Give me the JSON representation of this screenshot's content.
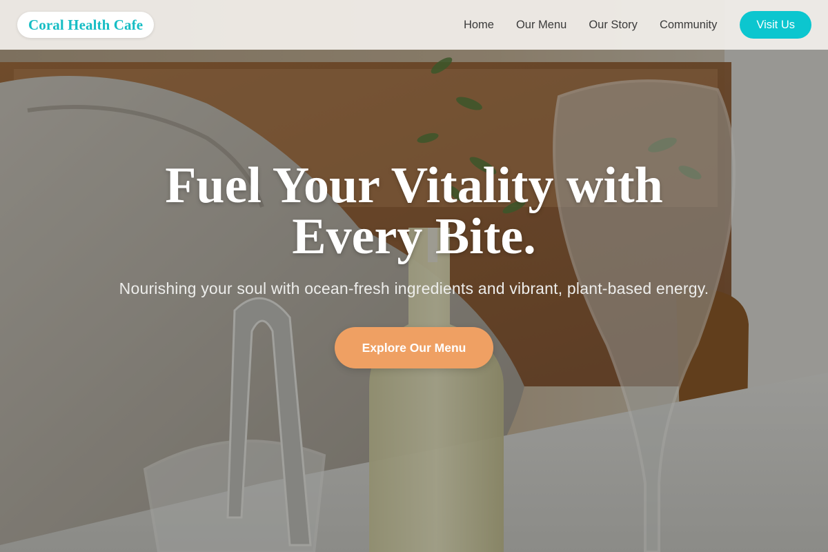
{
  "brand": {
    "name": "Coral Health Cafe"
  },
  "nav": {
    "links": [
      "Home",
      "Our Menu",
      "Our Story",
      "Community"
    ],
    "cta_label": "Visit Us"
  },
  "hero": {
    "title": "Fuel Your Vitality with Every Bite.",
    "subtitle": "Nourishing your soul with ocean-fresh ingredients and vibrant, plant-based energy.",
    "cta_label": "Explore Our Menu",
    "background": "cafe table with glass, bottle and tongs"
  },
  "colors": {
    "brand_teal": "#16bdc4",
    "visit_button": "#0cc6cf",
    "cta_orange": "#efa063",
    "nav_background": "#f3f0ec"
  }
}
